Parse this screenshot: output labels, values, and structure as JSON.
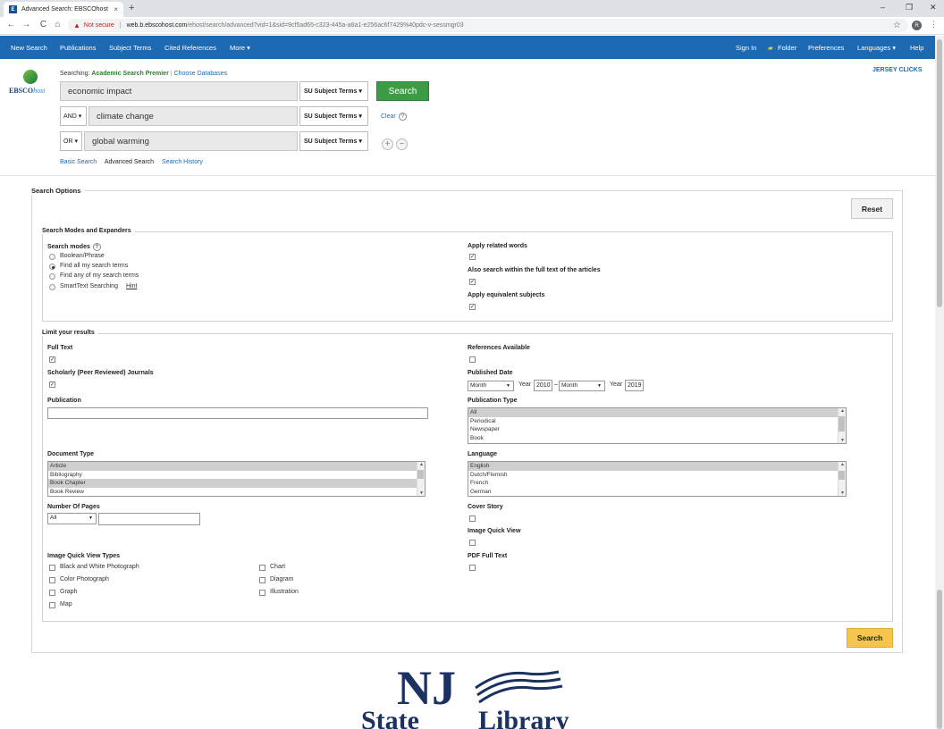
{
  "browser": {
    "tab_title": "Advanced Search: EBSCOhost",
    "tab_favicon": "E",
    "close": "×",
    "new_tab": "+",
    "minimize": "–",
    "restore": "❐",
    "window_close": "✕",
    "back": "←",
    "forward": "→",
    "reload": "C",
    "not_secure": "Not secure",
    "url_host": "web.b.ebscohost.com",
    "url_path": "/ehost/search/advanced?vid=1&sid=9cf5ad65-c323-445a-a8a1-e256ac6f7429%40pdc-v-sessmgr03",
    "profile_initial": "R"
  },
  "topnav": {
    "left": [
      "New Search",
      "Publications",
      "Subject Terms",
      "Cited References",
      "More ▾"
    ],
    "right": [
      "Sign In",
      "Folder",
      "Preferences",
      "Languages ▾",
      "Help"
    ]
  },
  "header": {
    "logo_text_1": "EBSCO",
    "logo_text_2": "host",
    "searching_label": "Searching:",
    "database": "Academic Search Premier",
    "choose_databases": "Choose Databases",
    "jersey_clicks": "JERSEY CLICKS"
  },
  "search_rows": [
    {
      "bool": "",
      "term": "economic impact",
      "field": "SU Subject Terms ▾"
    },
    {
      "bool": "AND ▾",
      "term": "climate change",
      "field": "SU Subject Terms ▾"
    },
    {
      "bool": "OR ▾",
      "term": "global warming",
      "field": "SU Subject Terms ▾"
    }
  ],
  "search_button": "Search",
  "clear": "Clear",
  "help_mark": "?",
  "add_row": "+",
  "remove_row": "−",
  "sublinks": [
    "Basic Search",
    "Advanced Search",
    "Search History"
  ],
  "options": {
    "title": "Search Options",
    "reset": "Reset",
    "modes_title": "Search Modes and Expanders",
    "modes_label": "Search modes",
    "modes": [
      "Boolean/Phrase",
      "Find all my search terms",
      "Find any of my search terms",
      "SmartText Searching"
    ],
    "hint": "Hint",
    "apply_related": "Apply related words",
    "full_text_search": "Also search within the full text of the articles",
    "equivalent_subjects": "Apply equivalent subjects",
    "limit_title": "Limit your results",
    "full_text": "Full Text",
    "scholarly": "Scholarly (Peer Reviewed) Journals",
    "publication": "Publication",
    "references_available": "References Available",
    "published_date": "Published Date",
    "month": "Month",
    "year_label": "Year",
    "year_from": "2010",
    "year_to": "2019",
    "date_dash": "–",
    "publication_type": "Publication Type",
    "publication_types": [
      "All",
      "Periodical",
      "Newspaper",
      "Book"
    ],
    "document_type": "Document Type",
    "document_types": [
      "Article",
      "Bibliography",
      "Book Chapter",
      "Book Review"
    ],
    "language": "Language",
    "languages": [
      "English",
      "Dutch/Flemish",
      "French",
      "German"
    ],
    "number_of_pages": "Number Of Pages",
    "pages_select": "All",
    "cover_story": "Cover Story",
    "image_quick_view": "Image Quick View",
    "pdf_full_text": "PDF Full Text",
    "iqv_types_label": "Image Quick View Types",
    "iqv_types": [
      "Black and White Photograph",
      "Color Photograph",
      "Graph",
      "Map",
      "Chart",
      "Diagram",
      "Illustration"
    ],
    "search": "Search"
  },
  "footer_logo": {
    "line1": "NJ",
    "line2": "State",
    "line3": "Library"
  },
  "colors": {
    "nav": "#1d6ab2",
    "search_green": "#3d9b45",
    "search_yellow": "#f5c54f",
    "nj_navy": "#1b3160"
  }
}
